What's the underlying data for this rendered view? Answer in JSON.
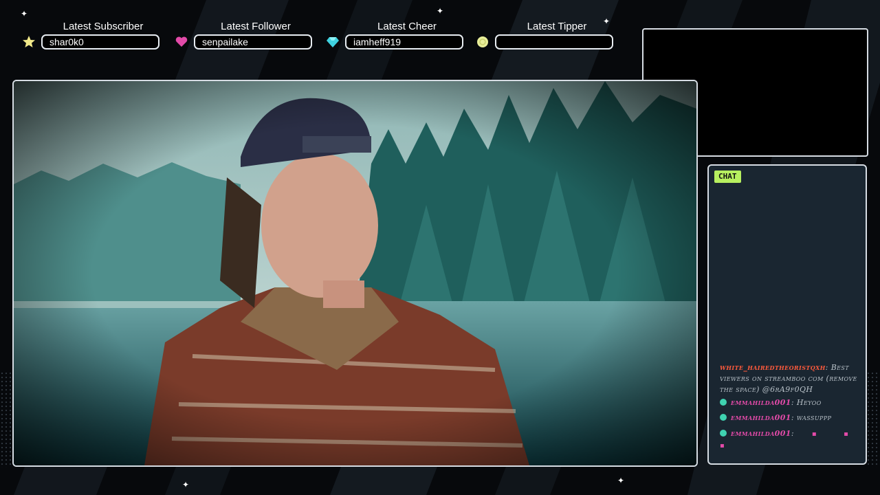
{
  "alerts": [
    {
      "title": "Latest Subscriber",
      "value": "shar0k0",
      "icon": "star-icon",
      "color": "#f1e98a"
    },
    {
      "title": "Latest Follower",
      "value": "senpailake",
      "icon": "heart-icon",
      "color": "#e24aa8"
    },
    {
      "title": "Latest Cheer",
      "value": "iamheff919",
      "icon": "gem-icon",
      "color": "#3fd2e0"
    },
    {
      "title": "Latest Tipper",
      "value": "",
      "icon": "coin-icon",
      "color": "#e8ee9a"
    }
  ],
  "chat": {
    "tab_label": "CHAT",
    "messages": [
      {
        "user": "white_hairedtheoristqxh",
        "sep": ":",
        "text": "Best viewers on streamboo com (remove the space) @6rA9f0QH"
      },
      {
        "user": "emmahilda001",
        "sep": ":",
        "text": "Heyoo"
      },
      {
        "user": "emmahilda001",
        "sep": ":",
        "text": "wassuppp"
      },
      {
        "user": "emmahilda001",
        "sep": ":",
        "text": "▪ ▪ ▪"
      }
    ]
  },
  "colors": {
    "accent_green": "#b7ef5f",
    "accent_pink": "#e24aa8",
    "frame_border": "#d7dde4",
    "panel_bg": "#1a2631"
  }
}
